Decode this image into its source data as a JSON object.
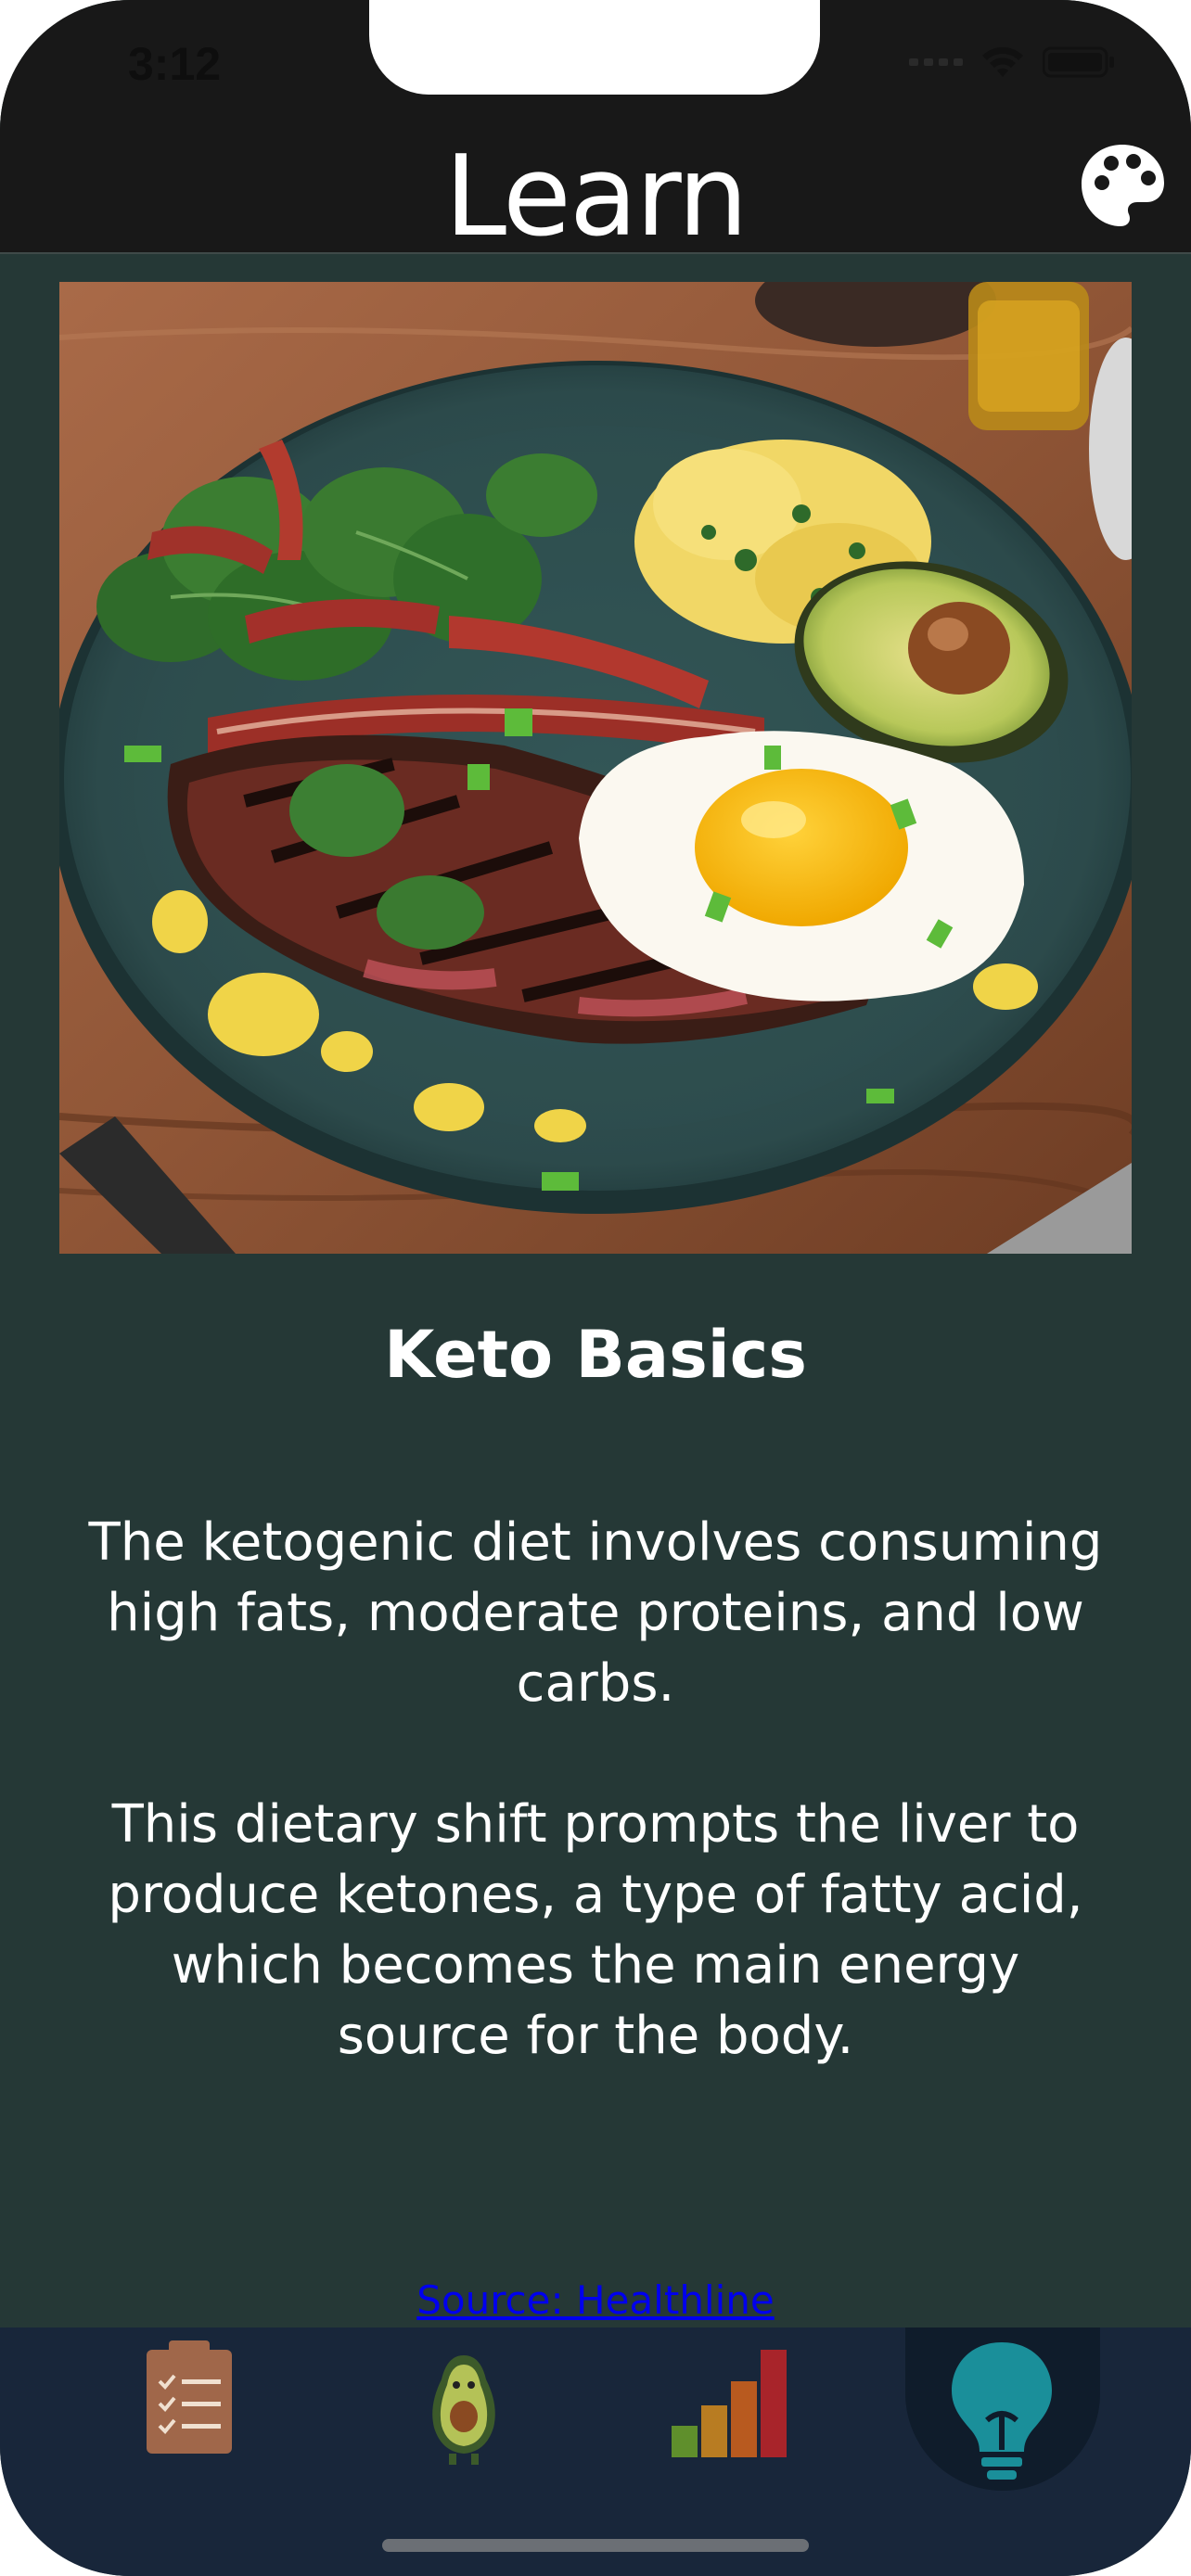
{
  "status_bar": {
    "time": "3:12"
  },
  "header": {
    "title": "Learn",
    "palette_icon": "palette-icon"
  },
  "article": {
    "image_subject": "steak-eggs-bacon-avocado-plate",
    "title": "Keto Basics",
    "paragraphs": [
      "The ketogenic diet involves consuming high fats, moderate proteins, and low carbs.",
      "This dietary shift prompts the liver to produce ketones, a type of fatty acid, which becomes the main energy source for the body."
    ],
    "source_link": "Source: Healthline"
  },
  "tabbar": {
    "tabs": [
      {
        "icon": "clipboard-checklist-icon",
        "active": false
      },
      {
        "icon": "avocado-icon",
        "active": false
      },
      {
        "icon": "bar-chart-icon",
        "active": false
      },
      {
        "icon": "lightbulb-icon",
        "active": true
      }
    ]
  },
  "colors": {
    "background": "#253836",
    "header": "#181818",
    "tabbar": "#18263a",
    "active_tab": "#1a8f9a",
    "link": "#0000ee"
  }
}
